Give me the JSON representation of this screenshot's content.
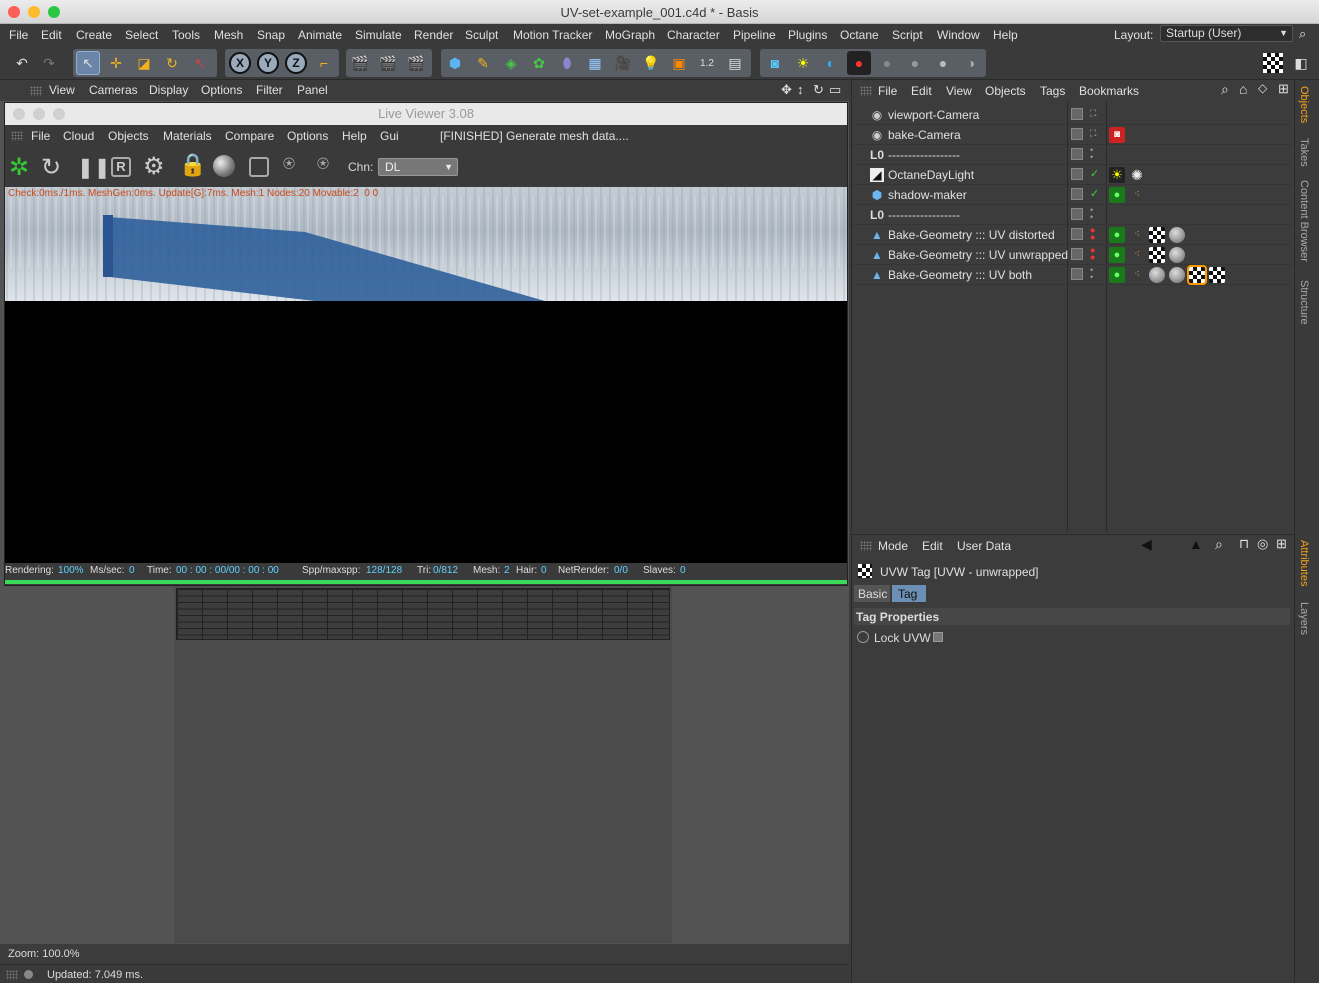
{
  "window": {
    "title": "UV-set-example_001.c4d * - Basis"
  },
  "menubar": {
    "items": [
      "File",
      "Edit",
      "Create",
      "Select",
      "Tools",
      "Mesh",
      "Snap",
      "Animate",
      "Simulate",
      "Render",
      "Sculpt",
      "Motion Tracker",
      "MoGraph",
      "Character",
      "Pipeline",
      "Plugins",
      "Octane",
      "Script",
      "Window",
      "Help"
    ],
    "layout_label": "Layout:",
    "layout_value": "Startup (User)"
  },
  "viewport": {
    "menu": [
      "View",
      "Cameras",
      "Display",
      "Options",
      "Filter",
      "Panel"
    ],
    "zoom": "Zoom: 100.0%",
    "status": "Updated: 7.049 ms."
  },
  "live_viewer": {
    "title": "Live Viewer 3.08",
    "menu": [
      "File",
      "Cloud",
      "Objects",
      "Materials",
      "Compare",
      "Options",
      "Help",
      "Gui"
    ],
    "message": "[FINISHED] Generate mesh data....",
    "chn_label": "Chn:",
    "chn_value": "DL",
    "overlay": "Check:0ms./1ms. MeshGen:0ms. Update[G]:7ms. Mesh:1 Nodes:20 Movable:2  0 0",
    "stats": {
      "rendering_label": "Rendering:",
      "rendering": "100%",
      "ms_label": "Ms/sec:",
      "ms": "0",
      "time_label": "Time:",
      "time": "00 : 00 : 00/00 : 00 : 00",
      "spp_label": "Spp/maxspp:",
      "spp": "128/128",
      "tri_label": "Tri:",
      "tri": "0/812",
      "mesh_label": "Mesh:",
      "mesh": "2",
      "hair_label": "Hair:",
      "hair": "0",
      "net_label": "NetRender:",
      "net": "0/0",
      "slaves_label": "Slaves:",
      "slaves": "0"
    },
    "progress": 1.0
  },
  "object_manager": {
    "menu": [
      "File",
      "Edit",
      "View",
      "Objects",
      "Tags",
      "Bookmarks"
    ],
    "objects": [
      {
        "name": "viewport-Camera"
      },
      {
        "name": "bake-Camera"
      },
      {
        "name": "------------------"
      },
      {
        "name": "OctaneDayLight"
      },
      {
        "name": "shadow-maker"
      },
      {
        "name": "------------------"
      },
      {
        "name": "Bake-Geometry ::: UV distorted"
      },
      {
        "name": "Bake-Geometry ::: UV unwrapped"
      },
      {
        "name": "Bake-Geometry ::: UV both"
      }
    ]
  },
  "attributes": {
    "menu": [
      "Mode",
      "Edit",
      "User Data"
    ],
    "header": "UVW Tag [UVW - unwrapped]",
    "tabs": [
      "Basic",
      "Tag"
    ],
    "section": "Tag Properties",
    "lock_label": "Lock UVW"
  },
  "side_tabs": [
    "Objects",
    "Takes",
    "Content Browser",
    "Structure",
    "Attributes",
    "Layers"
  ]
}
